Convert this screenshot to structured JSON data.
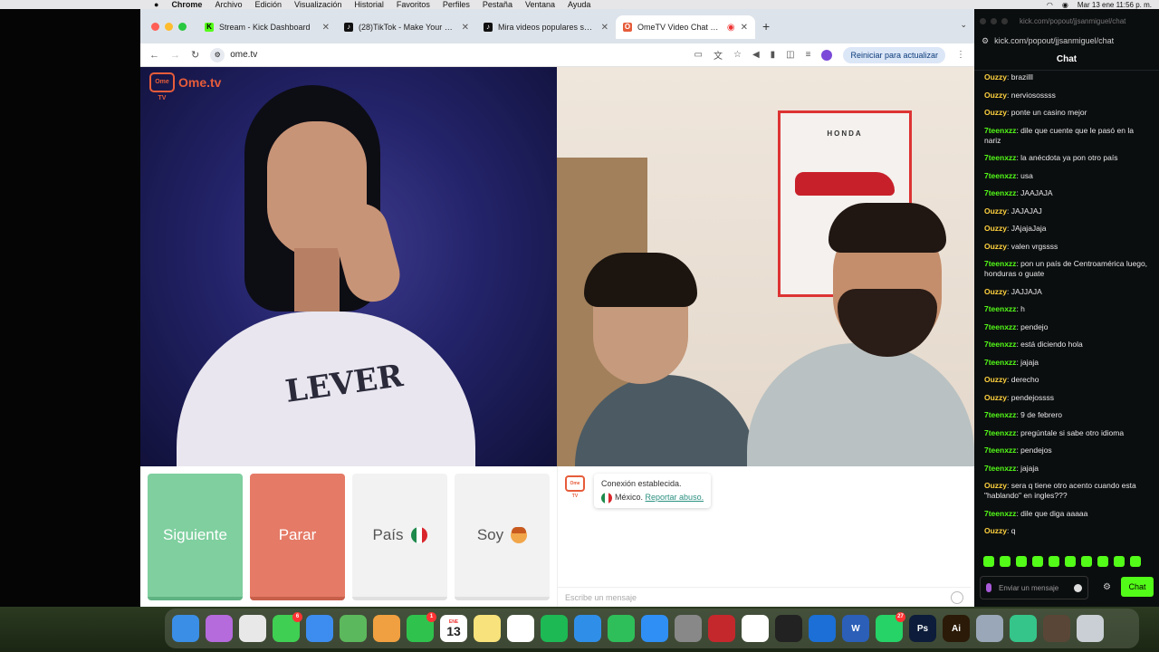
{
  "menubar": {
    "app": "Chrome",
    "items": [
      "Archivo",
      "Edición",
      "Visualización",
      "Historial",
      "Favoritos",
      "Perfiles",
      "Pestaña",
      "Ventana",
      "Ayuda"
    ],
    "clock": "Mar 13 ene  11:56 p. m."
  },
  "browser": {
    "tabs": [
      {
        "title": "Stream - Kick Dashboard",
        "favicon_color": "#53fc18",
        "favicon_char": "K",
        "active": false
      },
      {
        "title": "(28)TikTok - Make Your Day",
        "favicon_color": "#111111",
        "favicon_char": "♪",
        "active": false
      },
      {
        "title": "Mira videos populares selecc",
        "favicon_color": "#111111",
        "favicon_char": "♪",
        "active": false
      },
      {
        "title": "OmeTV Video Chat — Om",
        "favicon_color": "#e65c3a",
        "favicon_char": "O",
        "active": true
      }
    ],
    "url": "ome.tv",
    "update_button": "Reiniciar para actualizar"
  },
  "ome": {
    "logo_text": "Ome.tv",
    "logo_box": "Ome TV",
    "buttons": {
      "next": "Siguiente",
      "stop": "Parar",
      "country": "País",
      "soy": "Soy"
    },
    "system_message": {
      "line1": "Conexión establecida.",
      "country": "México.",
      "report": "Reportar abuso."
    },
    "message_placeholder": "Escribe un mensaje",
    "poster_brand": "HONDA",
    "sweater_print": "LEVER"
  },
  "kick": {
    "url": "kick.com/popout/jjsanmiguel/chat",
    "title_url": "kick.com/popout/jjsanmiguel/chat",
    "header": "Chat",
    "messages": [
      {
        "user": "Ouzzy",
        "text": "brazilll"
      },
      {
        "user": "Ouzzy",
        "text": "nerviosossss"
      },
      {
        "user": "Ouzzy",
        "text": "ponte un casino mejor"
      },
      {
        "user": "7teenxzz",
        "text": "dile que cuente que le pasó en la nariz"
      },
      {
        "user": "7teenxzz",
        "text": "la anécdota ya pon otro país"
      },
      {
        "user": "7teenxzz",
        "text": "usa"
      },
      {
        "user": "7teenxzz",
        "text": "JAAJAJA"
      },
      {
        "user": "Ouzzy",
        "text": "JAJAJAJ"
      },
      {
        "user": "Ouzzy",
        "text": "JAjajaJaja"
      },
      {
        "user": "Ouzzy",
        "text": "valen vrgssss"
      },
      {
        "user": "7teenxzz",
        "text": "pon un país de Centroamérica luego, honduras o guate"
      },
      {
        "user": "Ouzzy",
        "text": "JAJJAJA"
      },
      {
        "user": "7teenxzz",
        "text": "h"
      },
      {
        "user": "7teenxzz",
        "text": "pendejo"
      },
      {
        "user": "7teenxzz",
        "text": "está diciendo hola"
      },
      {
        "user": "7teenxzz",
        "text": "jajaja"
      },
      {
        "user": "Ouzzy",
        "text": "derecho"
      },
      {
        "user": "Ouzzy",
        "text": "pendejossss"
      },
      {
        "user": "7teenxzz",
        "text": "9 de febrero"
      },
      {
        "user": "7teenxzz",
        "text": "pregúntale si sabe otro idioma"
      },
      {
        "user": "7teenxzz",
        "text": "pendejos"
      },
      {
        "user": "7teenxzz",
        "text": "jajaja"
      },
      {
        "user": "Ouzzy",
        "text": "sera q tiene otro acento cuando esta \"hablando\" en ingles???"
      },
      {
        "user": "7teenxzz",
        "text": "dile que diga aaaaa"
      },
      {
        "user": "Ouzzy",
        "text": "q"
      }
    ],
    "input_placeholder": "Enviar un mensaje",
    "send_label": "Chat"
  },
  "dock": {
    "apps": [
      {
        "name": "finder-icon",
        "color": "#3a8ee6",
        "label": ""
      },
      {
        "name": "launchpad-icon",
        "color": "#b56bdb",
        "label": ""
      },
      {
        "name": "chrome-icon",
        "color": "#e8e8e8",
        "label": ""
      },
      {
        "name": "messages-icon",
        "color": "#3fcf52",
        "label": "",
        "badge": "6"
      },
      {
        "name": "mail-icon",
        "color": "#3d8cf0",
        "label": ""
      },
      {
        "name": "maps-icon",
        "color": "#5cb85c",
        "label": ""
      },
      {
        "name": "photos-icon",
        "color": "#f0a040",
        "label": ""
      },
      {
        "name": "facetime-icon",
        "color": "#2fc34d",
        "label": "",
        "badge": "1"
      },
      {
        "name": "calendar-icon",
        "color": "#ffffff",
        "label": "13",
        "sub": "ENE"
      },
      {
        "name": "notes-icon",
        "color": "#f7e27b",
        "label": ""
      },
      {
        "name": "freeform-icon",
        "color": "#ffffff",
        "label": ""
      },
      {
        "name": "spotify-icon",
        "color": "#1db954",
        "label": ""
      },
      {
        "name": "keynote-icon",
        "color": "#2f8fe8",
        "label": ""
      },
      {
        "name": "numbers-icon",
        "color": "#2fbf5a",
        "label": ""
      },
      {
        "name": "appstore-icon",
        "color": "#2f8ff5",
        "label": ""
      },
      {
        "name": "settings-icon",
        "color": "#888888",
        "label": ""
      },
      {
        "name": "photobooth-icon",
        "color": "#c4282c",
        "label": ""
      },
      {
        "name": "tiktok-studio-icon",
        "color": "#ffffff",
        "label": ""
      },
      {
        "name": "obs-icon",
        "color": "#222222",
        "label": ""
      },
      {
        "name": "xcode-icon",
        "color": "#1b6fd6",
        "label": ""
      },
      {
        "name": "word-icon",
        "color": "#2b5fb8",
        "label": "W"
      },
      {
        "name": "whatsapp-icon",
        "color": "#25d366",
        "label": "",
        "badge": "27"
      },
      {
        "name": "photoshop-icon",
        "color": "#0c1c3a",
        "label": "Ps"
      },
      {
        "name": "illustrator-icon",
        "color": "#2b1a08",
        "label": "Ai"
      },
      {
        "name": "preview-icon",
        "color": "#9aa7b8",
        "label": ""
      },
      {
        "name": "browser-icon",
        "color": "#35c58a",
        "label": ""
      },
      {
        "name": "stack-icon",
        "color": "#5a4636",
        "label": ""
      },
      {
        "name": "trash-icon",
        "color": "#c9cfd4",
        "label": ""
      }
    ]
  }
}
